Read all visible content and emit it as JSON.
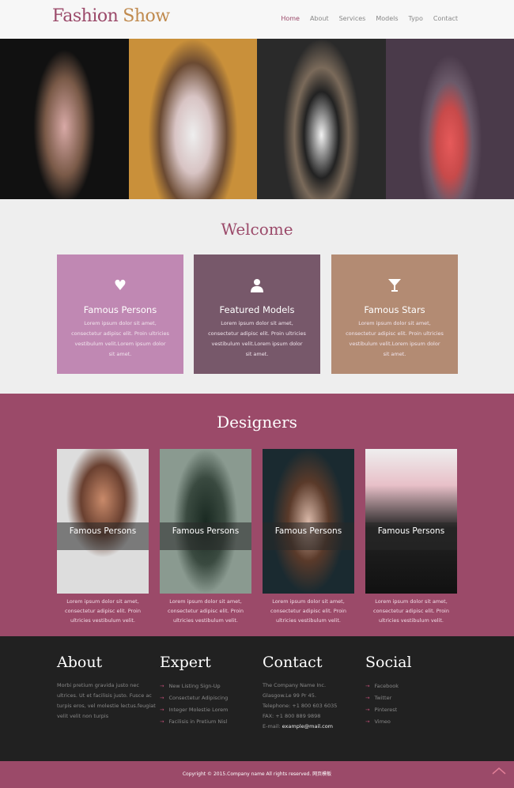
{
  "header": {
    "logo_part1": "Fashion",
    "logo_part2": "Show",
    "nav": [
      "Home",
      "About",
      "Services",
      "Models",
      "Typo",
      "Contact"
    ],
    "active": "Home"
  },
  "hero": {
    "photos": [
      "model-pink-top",
      "model-floral-skirt",
      "model-white-vest",
      "model-red-dress"
    ]
  },
  "welcome": {
    "title": "Welcome",
    "cards": [
      {
        "icon": "heart-icon",
        "title": "Famous Persons",
        "text": "Lorem ipsum dolor sit amet, consectetur adipisc elit. Proin ultricies vestibulum velit.Lorem ipsum dolor sit amet.",
        "color": "#c088b3"
      },
      {
        "icon": "user-icon",
        "title": "Featured Models",
        "text": "Lorem ipsum dolor sit amet, consectetur adipisc elit. Proin ultricies vestibulum velit.Lorem ipsum dolor sit amet.",
        "color": "#77586a"
      },
      {
        "icon": "glass-icon",
        "title": "Famous Stars",
        "text": "Lorem ipsum dolor sit amet, consectetur adipisc elit. Proin ultricies vestibulum velit.Lorem ipsum dolor sit amet.",
        "color": "#b38b73"
      }
    ]
  },
  "designers": {
    "title": "Designers",
    "items": [
      {
        "label": "Famous Persons",
        "text": "Lorem ipsum dolor sit amet, consectetur adipisc elit. Proin ultricies vestibulum velit."
      },
      {
        "label": "Famous Persons",
        "text": "Lorem ipsum dolor sit amet, consectetur adipisc elit. Proin ultricies vestibulum velit."
      },
      {
        "label": "Famous Persons",
        "text": "Lorem ipsum dolor sit amet, consectetur adipisc elit. Proin ultricies vestibulum velit."
      },
      {
        "label": "Famous Persons",
        "text": "Lorem ipsum dolor sit amet, consectetur adipisc elit. Proin ultricies vestibulum velit."
      }
    ]
  },
  "footer": {
    "about": {
      "title": "About",
      "text": "Morbi pretium gravida justo nec ultrices. Ut et facilisis justo. Fusce ac turpis eros, vel molestie lectus.feugiat velit velit non turpis"
    },
    "expert": {
      "title": "Expert",
      "links": [
        "New Listing Sign-Up",
        "Consectetur Adipiscing",
        "Integer Molestie Lorem",
        "Facilisis in Pretium Nisl"
      ]
    },
    "contact": {
      "title": "Contact",
      "lines": [
        "The Company Name Inc.",
        "Glasgow.Le 99 Pr 45.",
        "Telephone: +1 800 603 6035",
        "FAX: +1 800 889 9898"
      ],
      "email_label": "E-mail:",
      "email": "example@mail.com"
    },
    "social": {
      "title": "Social",
      "links": [
        "Facebook",
        "Twitter",
        "Pinterest",
        "Vimeo"
      ]
    }
  },
  "copyright": "Copyright © 2015.Company name All rights reserved. 网页模板",
  "colors": {
    "brand": "#9b4a6a",
    "footer": "#212121"
  }
}
